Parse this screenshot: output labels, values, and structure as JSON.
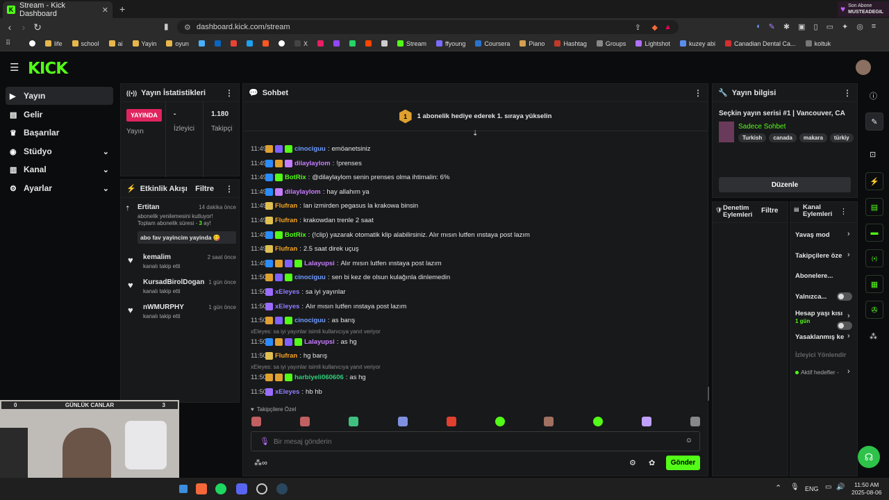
{
  "browser": {
    "tab_title": "Stream - Kick Dashboard",
    "url": "dashboard.kick.com/stream",
    "notif_title": "Son Abone",
    "notif_user": "MUSTEADEGIL"
  },
  "bookmarks": [
    "life",
    "school",
    "ai",
    "Yayin",
    "oyun",
    "X",
    "Stream",
    "ffyoung",
    "Coursera",
    "Piano",
    "Hashtag",
    "Groups",
    "Lightshot",
    "kuzey abi",
    "Canadian Dental Ca...",
    "koltuk"
  ],
  "sidebar": {
    "items": [
      {
        "label": "Yayın"
      },
      {
        "label": "Gelir"
      },
      {
        "label": "Başarılar"
      },
      {
        "label": "Stüdyo"
      },
      {
        "label": "Kanal"
      },
      {
        "label": "Ayarlar"
      }
    ]
  },
  "stats": {
    "title": "Yayın İstatistikleri",
    "live_badge": "YAYINDA",
    "live_label": "Yayın",
    "viewers_value": "-",
    "viewers_label": "İzleyici",
    "followers_value": "1.180",
    "followers_label": "Takipçi"
  },
  "activity": {
    "title": "Etkinlik Akışı",
    "filter": "Filtre",
    "items": [
      {
        "user": "Ertitan",
        "time": "14 dakika önce",
        "desc1": "abonelik yenilemesini kutluyor!",
        "desc2": "Toplam abonelik süresi - ",
        "months": "3",
        "desc3": " ay!",
        "message": "abo fav yayincim yayinda 😋"
      },
      {
        "user": "kemalim",
        "time": "2 saat önce",
        "desc1": "kanalı takip etti"
      },
      {
        "user": "KursadBirolDogan",
        "time": "1 gün önce",
        "desc1": "kanalı takip etti"
      },
      {
        "user": "nWMURPHY",
        "time": "1 gün önce",
        "desc1": "kanalı takip etti"
      }
    ]
  },
  "chat": {
    "title": "Sohbet",
    "banner": "1 abonelik hediye ederek 1. sıraya yükselin",
    "messages": [
      {
        "time": "11:49",
        "user": "cinociguu",
        "color": "#6f9cff",
        "text": "emöanetsiniz"
      },
      {
        "time": "11:49",
        "user": "dilaylaylom",
        "color": "#c77dff",
        "text": "!prenses"
      },
      {
        "time": "11:49",
        "user": "BotRix",
        "color": "#53fc18",
        "text": "@dilaylaylom senin prenses olma ihtimalin: 6%"
      },
      {
        "time": "11:49",
        "user": "dilaylaylom",
        "color": "#c77dff",
        "text": "hay allahım ya"
      },
      {
        "time": "11:49",
        "user": "Flufran",
        "color": "#f5a623",
        "text": "lan izmirden pegasus la krakowa binsin"
      },
      {
        "time": "11:49",
        "user": "Flufran",
        "color": "#f5a623",
        "text": "krakowdan trenle 2 saat"
      },
      {
        "time": "11:49",
        "user": "BotRix",
        "color": "#53fc18",
        "text": "(!clip) yazarak otomatik klip alabilirsiniz. Alır mısın lutfen ınstaya post lazım"
      },
      {
        "time": "11:49",
        "user": "Flufran",
        "color": "#f5a623",
        "text": "2.5 saat direk uçuş"
      },
      {
        "time": "11:49",
        "user": "Lalayupsi",
        "color": "#c77dff",
        "text": "Alır mısın lutfen ınstaya post lazım"
      },
      {
        "time": "11:50",
        "user": "cinociguu",
        "color": "#6f9cff",
        "text": "sen bi kez de olsun kulağınla dinlemedin"
      },
      {
        "time": "11:50",
        "user": "xEleyes",
        "color": "#8f7dff",
        "text": "sa iyi yayınlar"
      },
      {
        "time": "11:50",
        "user": "xEleyes",
        "color": "#8f7dff",
        "text": "Alır mısın lutfen ınstaya post lazım"
      },
      {
        "time": "11:50",
        "user": "cinociguu",
        "color": "#6f9cff",
        "text": "as barış"
      },
      {
        "time": "11:50",
        "user": "Lalayupsi",
        "color": "#c77dff",
        "text": "as hg",
        "reply": "xEleyes: sa iyi yayınlar isimli kullanıcıya yanıt veriyor"
      },
      {
        "time": "11:50",
        "user": "Flufran",
        "color": "#f5a623",
        "text": "hg barış"
      },
      {
        "time": "11:50",
        "user": "harbiyeli060606",
        "color": "#2fd07a",
        "text": "as hg",
        "reply": "xEleyes: sa iyi yayınlar isimli kullanıcıya yanıt veriyor"
      },
      {
        "time": "11:50",
        "user": "xEleyes",
        "color": "#8f7dff",
        "text": "hb hb"
      }
    ],
    "followers_only": "Takipçilere Özel",
    "input_placeholder": "Bir mesaj gönderin",
    "send": "Gönder"
  },
  "stream_info": {
    "title": "Yayın bilgisi",
    "stream_title": "Seçkin yayın serisi #1 | Vancouver, CA",
    "category": "Sadece Sohbet",
    "tags": [
      "Turkish",
      "canada",
      "makara",
      "türkiy"
    ],
    "edit": "Düzenle"
  },
  "moderation": {
    "title": "Denetim Eylemleri",
    "filter": "Filtre"
  },
  "channel_actions": {
    "title": "Kanal Eylemleri",
    "items": [
      {
        "label": "Yavaş mod"
      },
      {
        "label": "Takipçilere öze"
      },
      {
        "label": "Abonelere..."
      },
      {
        "label": "Yalnızca..."
      },
      {
        "label": "Hesap yaşı kısı",
        "sub": "1 gün"
      },
      {
        "label": "Yasaklanmış ke"
      },
      {
        "label": "İzleyici Yönlendir"
      },
      {
        "label": "Aktif hedefler -"
      }
    ]
  },
  "webcam": {
    "left_count": "0",
    "title": "GÜNLÜK CANLAR",
    "right_count": "3"
  },
  "taskbar": {
    "lang": "ENG",
    "time": "11:50 AM",
    "date": "2025-08-06"
  },
  "colors": {
    "accent": "#53fc18",
    "live": "#e0245e"
  }
}
